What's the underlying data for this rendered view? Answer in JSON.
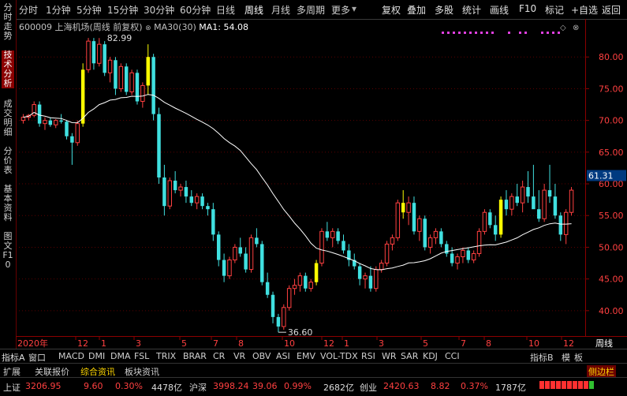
{
  "toolbar": {
    "periods": [
      "分时",
      "1分钟",
      "5分钟",
      "15分钟",
      "30分钟",
      "60分钟",
      "日线",
      "周线",
      "月线",
      "多周期",
      "更多"
    ],
    "active_period": "周线",
    "tools": [
      "复权",
      "叠加",
      "多股",
      "统计",
      "画线",
      "F10",
      "标记",
      "+自选",
      "返回"
    ]
  },
  "sidebar": {
    "tabs": [
      "分时走势",
      "技术分析",
      "成交明细",
      "分价表",
      "基本资料",
      "图文F10"
    ],
    "active": "技术分析"
  },
  "info": {
    "code": "600009",
    "name": "上海机场(周线 前复权)",
    "ma_label": "MA30(30)",
    "ma_value_label": "MA1:",
    "ma_value": "54.08"
  },
  "colors": {
    "up": "#ff4040",
    "down": "#40e0e0",
    "highlight": "#ffff00",
    "ma": "#ffffff",
    "grid": "#8b0000"
  },
  "chart_data": {
    "type": "candlestick",
    "y_ticks": [
      40.0,
      45.0,
      50.0,
      55.0,
      60.0,
      65.0,
      70.0,
      75.0,
      80.0
    ],
    "ylim": [
      36.0,
      86.0
    ],
    "current_price": "61.31",
    "annotations": [
      {
        "text": "82.99"
      },
      {
        "text": "36.60"
      }
    ],
    "x_ticks": [
      "2020年",
      "12",
      "1",
      "3",
      "5",
      "7",
      "8",
      "10",
      "12",
      "1",
      "3",
      "5",
      "7",
      "8",
      "10",
      "12",
      "周线"
    ],
    "candles": [
      [
        70,
        71,
        69.5,
        70.5
      ],
      [
        70.5,
        71,
        70,
        70.8
      ],
      [
        70.8,
        73,
        70.5,
        72.5
      ],
      [
        72.5,
        73,
        69,
        69.5
      ],
      [
        69.5,
        70.5,
        68.5,
        70
      ],
      [
        70,
        70.5,
        69,
        69.3
      ],
      [
        69.3,
        70.2,
        68.8,
        70
      ],
      [
        70,
        71,
        69.5,
        69.8
      ],
      [
        69.8,
        70,
        67,
        67.5
      ],
      [
        67.5,
        68,
        63,
        66.5
      ],
      [
        66.5,
        70,
        66,
        69.5
      ],
      [
        69.5,
        79,
        69,
        78
      ],
      [
        78,
        83,
        77.5,
        82.5
      ],
      [
        82.5,
        83,
        78,
        79
      ],
      [
        79,
        82.99,
        78.5,
        82
      ],
      [
        82,
        82.5,
        77,
        77.5
      ],
      [
        77.5,
        80,
        76,
        79.5
      ],
      [
        79.5,
        80,
        74,
        75
      ],
      [
        75,
        79,
        74.5,
        78.5
      ],
      [
        78.5,
        79,
        74,
        74.5
      ],
      [
        74.5,
        78,
        74,
        77.5
      ],
      [
        77.5,
        78,
        72.5,
        73
      ],
      [
        73,
        76,
        72,
        75.5
      ],
      [
        75.5,
        82,
        74,
        80
      ],
      [
        80,
        80.5,
        70,
        71
      ],
      [
        71,
        72,
        60,
        61
      ],
      [
        61,
        63,
        55,
        56.5
      ],
      [
        56.5,
        61,
        56,
        60.5
      ],
      [
        60.5,
        62,
        58.5,
        59
      ],
      [
        59,
        60,
        58,
        59.5
      ],
      [
        59.5,
        60.5,
        57,
        58
      ],
      [
        58,
        59,
        56.5,
        57
      ],
      [
        57,
        58.5,
        56,
        58
      ],
      [
        58,
        58.5,
        56,
        56.5
      ],
      [
        56.5,
        57,
        55,
        56
      ],
      [
        56,
        57,
        51,
        52
      ],
      [
        52,
        52.5,
        47,
        48
      ],
      [
        48,
        49,
        44.5,
        45.5
      ],
      [
        45.5,
        48.5,
        45,
        48
      ],
      [
        48,
        50.5,
        47.5,
        50
      ],
      [
        50,
        51.5,
        48.5,
        49
      ],
      [
        49,
        50,
        46,
        46.5
      ],
      [
        46.5,
        52,
        46,
        51.5
      ],
      [
        51.5,
        53,
        50,
        50.5
      ],
      [
        50.5,
        51,
        44,
        44.5
      ],
      [
        44.5,
        46,
        42,
        42.5
      ],
      [
        42.5,
        43,
        38,
        39
      ],
      [
        39,
        39.5,
        36.6,
        37.5
      ],
      [
        37.5,
        41,
        37,
        40.5
      ],
      [
        40.5,
        44,
        40,
        43.5
      ],
      [
        43.5,
        45,
        42.5,
        44
      ],
      [
        44,
        46,
        43,
        45.5
      ],
      [
        45.5,
        46,
        43,
        43.5
      ],
      [
        43.5,
        45,
        43,
        44.5
      ],
      [
        44.5,
        48,
        44,
        47.5
      ],
      [
        47.5,
        53,
        47,
        52.5
      ],
      [
        52.5,
        54,
        51,
        51.5
      ],
      [
        51.5,
        53,
        50,
        52.5
      ],
      [
        52.5,
        53,
        50.5,
        51
      ],
      [
        51,
        52,
        49,
        49.5
      ],
      [
        49.5,
        50.5,
        47,
        48
      ],
      [
        48,
        49,
        46.5,
        47
      ],
      [
        47,
        47.5,
        44,
        45
      ],
      [
        45,
        46,
        43.5,
        45.5
      ],
      [
        45.5,
        47,
        43,
        43.5
      ],
      [
        43.5,
        47,
        43,
        46.5
      ],
      [
        46.5,
        48,
        46,
        47.5
      ],
      [
        47.5,
        51,
        47,
        50.5
      ],
      [
        50.5,
        52,
        49.5,
        51.5
      ],
      [
        51.5,
        57.5,
        51,
        57
      ],
      [
        57,
        59,
        54.5,
        55.5
      ],
      [
        55.5,
        58,
        53.5,
        57
      ],
      [
        57,
        58,
        52,
        52.5
      ],
      [
        52.5,
        55,
        51,
        54.5
      ],
      [
        54.5,
        55,
        49.5,
        50
      ],
      [
        50,
        52,
        49,
        51.5
      ],
      [
        51.5,
        53,
        50.5,
        52.5
      ],
      [
        52.5,
        53,
        50,
        50.5
      ],
      [
        50.5,
        51,
        48.5,
        49
      ],
      [
        49,
        50,
        47,
        47.5
      ],
      [
        47.5,
        49,
        46.5,
        48.5
      ],
      [
        48.5,
        50,
        47.5,
        49.5
      ],
      [
        49.5,
        50,
        47.5,
        48
      ],
      [
        48,
        49.5,
        47.5,
        49
      ],
      [
        49,
        53,
        48.5,
        52.5
      ],
      [
        52.5,
        56,
        52,
        55.5
      ],
      [
        55.5,
        56,
        53,
        53.5
      ],
      [
        53.5,
        55,
        51,
        52
      ],
      [
        52,
        58,
        51.5,
        57.5
      ],
      [
        57.5,
        59,
        55,
        56
      ],
      [
        56,
        58.5,
        55,
        58
      ],
      [
        58,
        60,
        56.5,
        57
      ],
      [
        57,
        60.5,
        55.5,
        59.5
      ],
      [
        59.5,
        62,
        57,
        58
      ],
      [
        58,
        63,
        57.5,
        56
      ],
      [
        56,
        59,
        54,
        54.5
      ],
      [
        54.5,
        60,
        54,
        59
      ],
      [
        59,
        63,
        57,
        58
      ],
      [
        58,
        60,
        54.5,
        55
      ],
      [
        55,
        55.5,
        51,
        52
      ],
      [
        52,
        56,
        50.5,
        55.5
      ],
      [
        55.5,
        59.5,
        55,
        59
      ]
    ],
    "highlight_indices": [
      11,
      23,
      54,
      70,
      88
    ]
  },
  "indicators": {
    "items": [
      "指标A",
      "窗口",
      "MACD",
      "DMI",
      "DMA",
      "FSL",
      "TRIX",
      "BRAR",
      "CR",
      "VR",
      "OBV",
      "ASI",
      "EMV",
      "VOL-TDX",
      "RSI",
      "WR",
      "SAR",
      "KDJ",
      "CCI"
    ],
    "right": [
      "指标B",
      "模",
      "板"
    ]
  },
  "tabs": [
    "扩展",
    "关联报价",
    "综合资讯",
    "板块资讯",
    "侧边栏"
  ],
  "status": {
    "sh_name": "上证",
    "sh_val": "3206.95",
    "sh_chg": "9.60",
    "sh_pct": "0.30%",
    "sh_amt": "4478亿",
    "hs_name": "沪深",
    "hs_val": "3998.24",
    "hs_chg": "39.06",
    "hs_pct": "0.99%",
    "hs_amt": "2682亿",
    "cy_name": "创业",
    "cy_val": "2420.63",
    "cy_chg": "8.82",
    "cy_pct": "0.37%",
    "cy_amt": "1787亿"
  }
}
